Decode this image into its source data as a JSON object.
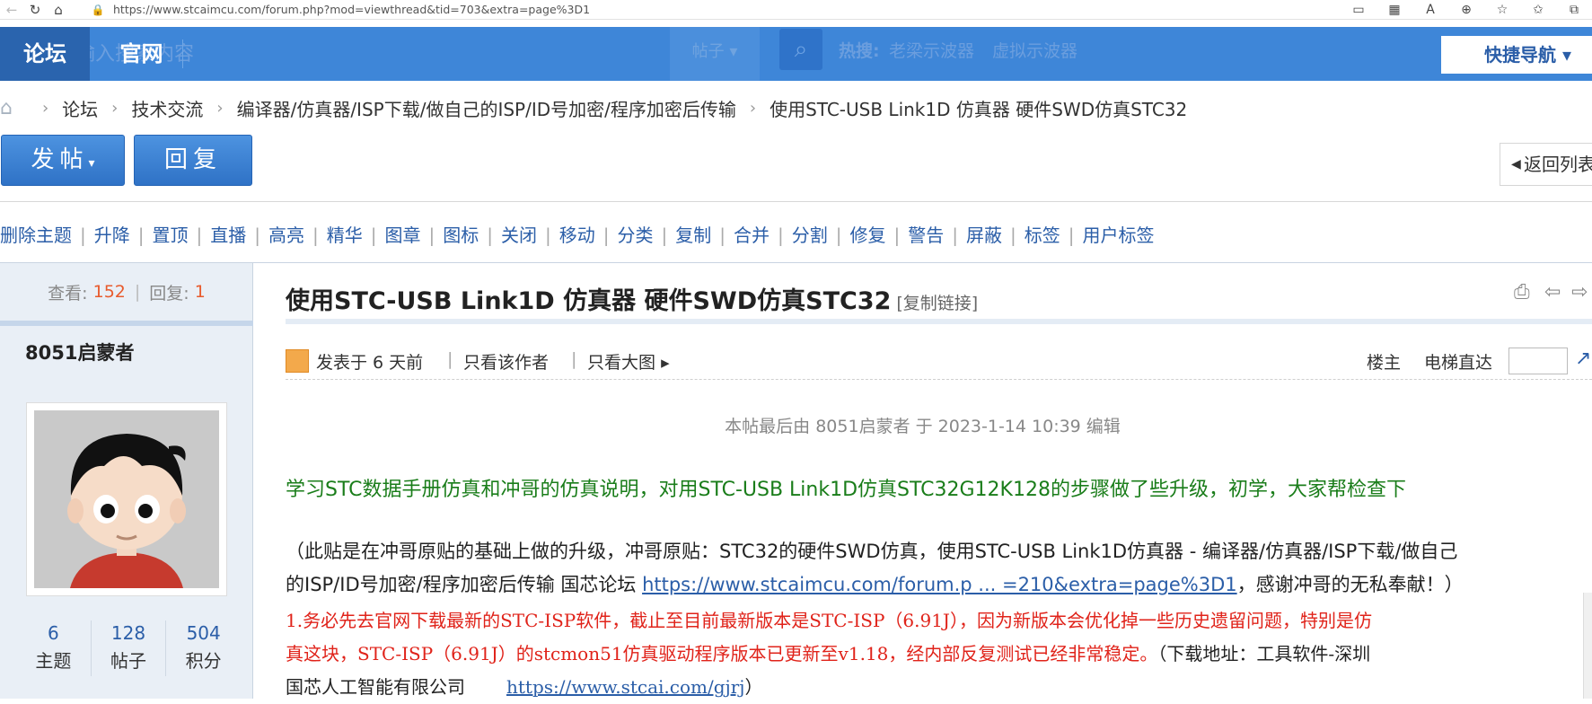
{
  "browser": {
    "url": "https://www.stcaimcu.com/forum.php?mod=viewthread&tid=703&extra=page%3D1"
  },
  "header": {
    "tab_forum": "论坛",
    "tab_site": "官网",
    "search_placeholder_ghost": "请输入搜索内容",
    "search_type": "帖子",
    "hot_label": "热搜:",
    "hot_items": [
      "老梁示波器",
      "虚拟示波器"
    ],
    "quick_nav": "快捷导航"
  },
  "breadcrumb": {
    "items": [
      "论坛",
      "技术交流",
      "编译器/仿真器/ISP下载/做自己的ISP/ID号加密/程序加密后传输",
      "使用STC-USB Link1D 仿真器 硬件SWD仿真STC32"
    ]
  },
  "buttons": {
    "post": "发帖",
    "reply": "回复",
    "back_list": "返回列表"
  },
  "mod_actions": [
    "删除主题",
    "升降",
    "置顶",
    "直播",
    "高亮",
    "精华",
    "图章",
    "图标",
    "关闭",
    "移动",
    "分类",
    "复制",
    "合并",
    "分割",
    "修复",
    "警告",
    "屏蔽",
    "标签",
    "用户标签"
  ],
  "thread_stats": {
    "views_label": "查看:",
    "views": "152",
    "replies_label": "回复:",
    "replies": "1"
  },
  "author": {
    "name": "8051启蒙者",
    "stats": [
      {
        "value": "6",
        "label": "主题"
      },
      {
        "value": "128",
        "label": "帖子"
      },
      {
        "value": "504",
        "label": "积分"
      }
    ]
  },
  "post": {
    "title": "使用STC-USB Link1D 仿真器 硬件SWD仿真STC32",
    "copy_link": "[复制链接]",
    "posted": "发表于 6 天前",
    "only_author": "只看该作者",
    "only_images": "只看大图",
    "floor": "楼主",
    "elevator": "电梯直达",
    "edited_note": "本帖最后由 8051启蒙者 于 2023-1-14 10:39 编辑",
    "intro": "学习STC数据手册仿真和冲哥的仿真说明，对用STC-USB Link1D仿真STC32G12K128的步骤做了些升级，初学，大家帮检查下",
    "para1_line1": "（此贴是在冲哥原贴的基础上做的升级，冲哥原贴：STC32的硬件SWD仿真，使用STC-USB Link1D仿真器 - 编译器/仿真器/ISP下载/做自己",
    "para1_line2_pre": "的ISP/ID号加密/程序加密后传输 国芯论坛 ",
    "para1_link": "https://www.stcaimcu.com/forum.p ... =210&extra=page%3D1",
    "para1_line2_post": "，感谢冲哥的无私奉献！）",
    "para2_line1": "1.务必先去官网下载最新的STC-ISP软件，截止至目前最新版本是STC-ISP（6.91J），因为新版本会优化掉一些历史遗留问题，特别是仿",
    "para2_line2_red": "真这块，STC-ISP（6.91J）的stcmon51仿真驱动程序版本已更新至v1.18，经内部反复测试已经非常稳定。",
    "para2_line2_black": "（下载地址：工具软件-深圳",
    "para2_line3_pre": "国芯人工智能有限公司",
    "para2_link": "https://www.stcai.com/gjrj",
    "para2_line3_post": "）"
  }
}
